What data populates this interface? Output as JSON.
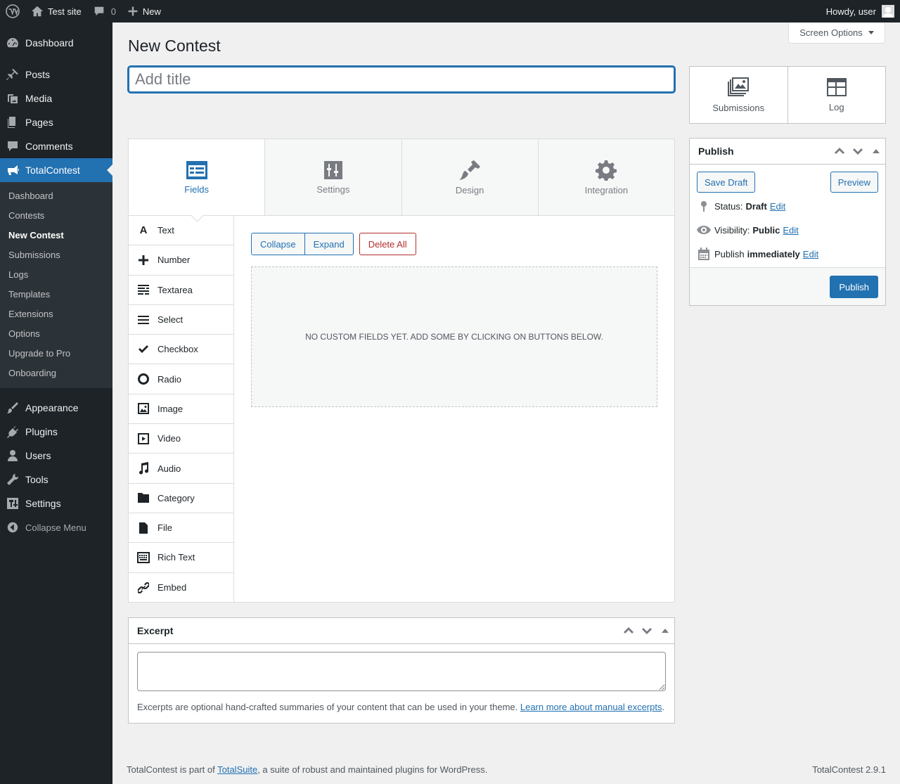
{
  "admin_bar": {
    "site_name": "Test site",
    "comments_count": "0",
    "new_label": "New",
    "greeting": "Howdy, user"
  },
  "sidebar": {
    "items": [
      {
        "label": "Dashboard",
        "icon": "dashboard-icon"
      },
      {
        "label": "Posts",
        "icon": "pin-icon"
      },
      {
        "label": "Media",
        "icon": "media-icon"
      },
      {
        "label": "Pages",
        "icon": "pages-icon"
      },
      {
        "label": "Comments",
        "icon": "comments-icon"
      },
      {
        "label": "TotalContest",
        "icon": "megaphone-icon"
      }
    ],
    "submenu": [
      "Dashboard",
      "Contests",
      "New Contest",
      "Submissions",
      "Logs",
      "Templates",
      "Extensions",
      "Options",
      "Upgrade to Pro",
      "Onboarding"
    ],
    "items_after": [
      {
        "label": "Appearance",
        "icon": "brush-icon"
      },
      {
        "label": "Plugins",
        "icon": "plugin-icon"
      },
      {
        "label": "Users",
        "icon": "users-icon"
      },
      {
        "label": "Tools",
        "icon": "wrench-icon"
      },
      {
        "label": "Settings",
        "icon": "settings-icon"
      }
    ],
    "collapse_label": "Collapse Menu"
  },
  "screen_options_label": "Screen Options",
  "page_title": "New Contest",
  "title_placeholder": "Add title",
  "builder": {
    "tabs": [
      "Fields",
      "Settings",
      "Design",
      "Integration"
    ],
    "field_types": [
      "Text",
      "Number",
      "Textarea",
      "Select",
      "Checkbox",
      "Radio",
      "Image",
      "Video",
      "Audio",
      "Category",
      "File",
      "Rich Text",
      "Embed"
    ],
    "collapse_label": "Collapse",
    "expand_label": "Expand",
    "delete_all_label": "Delete All",
    "empty_message": "No custom fields yet. Add some by clicking on buttons below."
  },
  "excerpt": {
    "title": "Excerpt",
    "help_text": "Excerpts are optional hand-crafted summaries of your content that can be used in your theme. ",
    "help_link": "Learn more about manual excerpts",
    "help_end": "."
  },
  "apps": {
    "submissions_label": "Submissions",
    "log_label": "Log"
  },
  "publish": {
    "title": "Publish",
    "save_draft_label": "Save Draft",
    "preview_label": "Preview",
    "status_label": "Status:",
    "status_value": "Draft",
    "visibility_label": "Visibility:",
    "visibility_value": "Public",
    "publish_label": "Publish",
    "publish_value": "immediately",
    "edit_label": "Edit",
    "publish_button": "Publish"
  },
  "footer": {
    "text_before": "TotalContest is part of ",
    "link": "TotalSuite",
    "text_after": ", a suite of robust and maintained plugins for WordPress.",
    "version": "TotalContest 2.9.1"
  },
  "colors": {
    "accent": "#2271b1",
    "admin_bar": "#1d2327",
    "danger": "#b32d2e"
  }
}
